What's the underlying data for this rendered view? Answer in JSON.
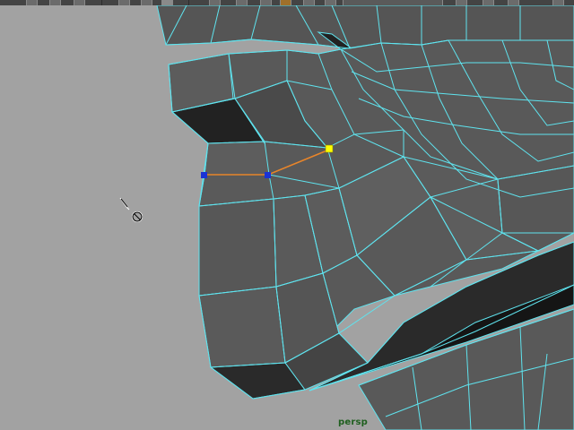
{
  "viewport": {
    "camera": "persp"
  },
  "toolbar": {
    "icons": [
      "new-scene-icon",
      "open-scene-icon",
      "save-scene-icon",
      "select-tool-icon",
      "lasso-tool-icon",
      "paint-select-icon",
      "grid-icon",
      "magnet-icon",
      "snap-icon",
      "render-icon",
      "ipr-icon",
      "settings-icon"
    ]
  },
  "colors": {
    "background": "#a2a2a2",
    "wireframe": "#5fe3ee",
    "selected_edge": "#e8852a",
    "selected_vertex": "#ffff00",
    "component_vertex": "#1a33d6"
  }
}
